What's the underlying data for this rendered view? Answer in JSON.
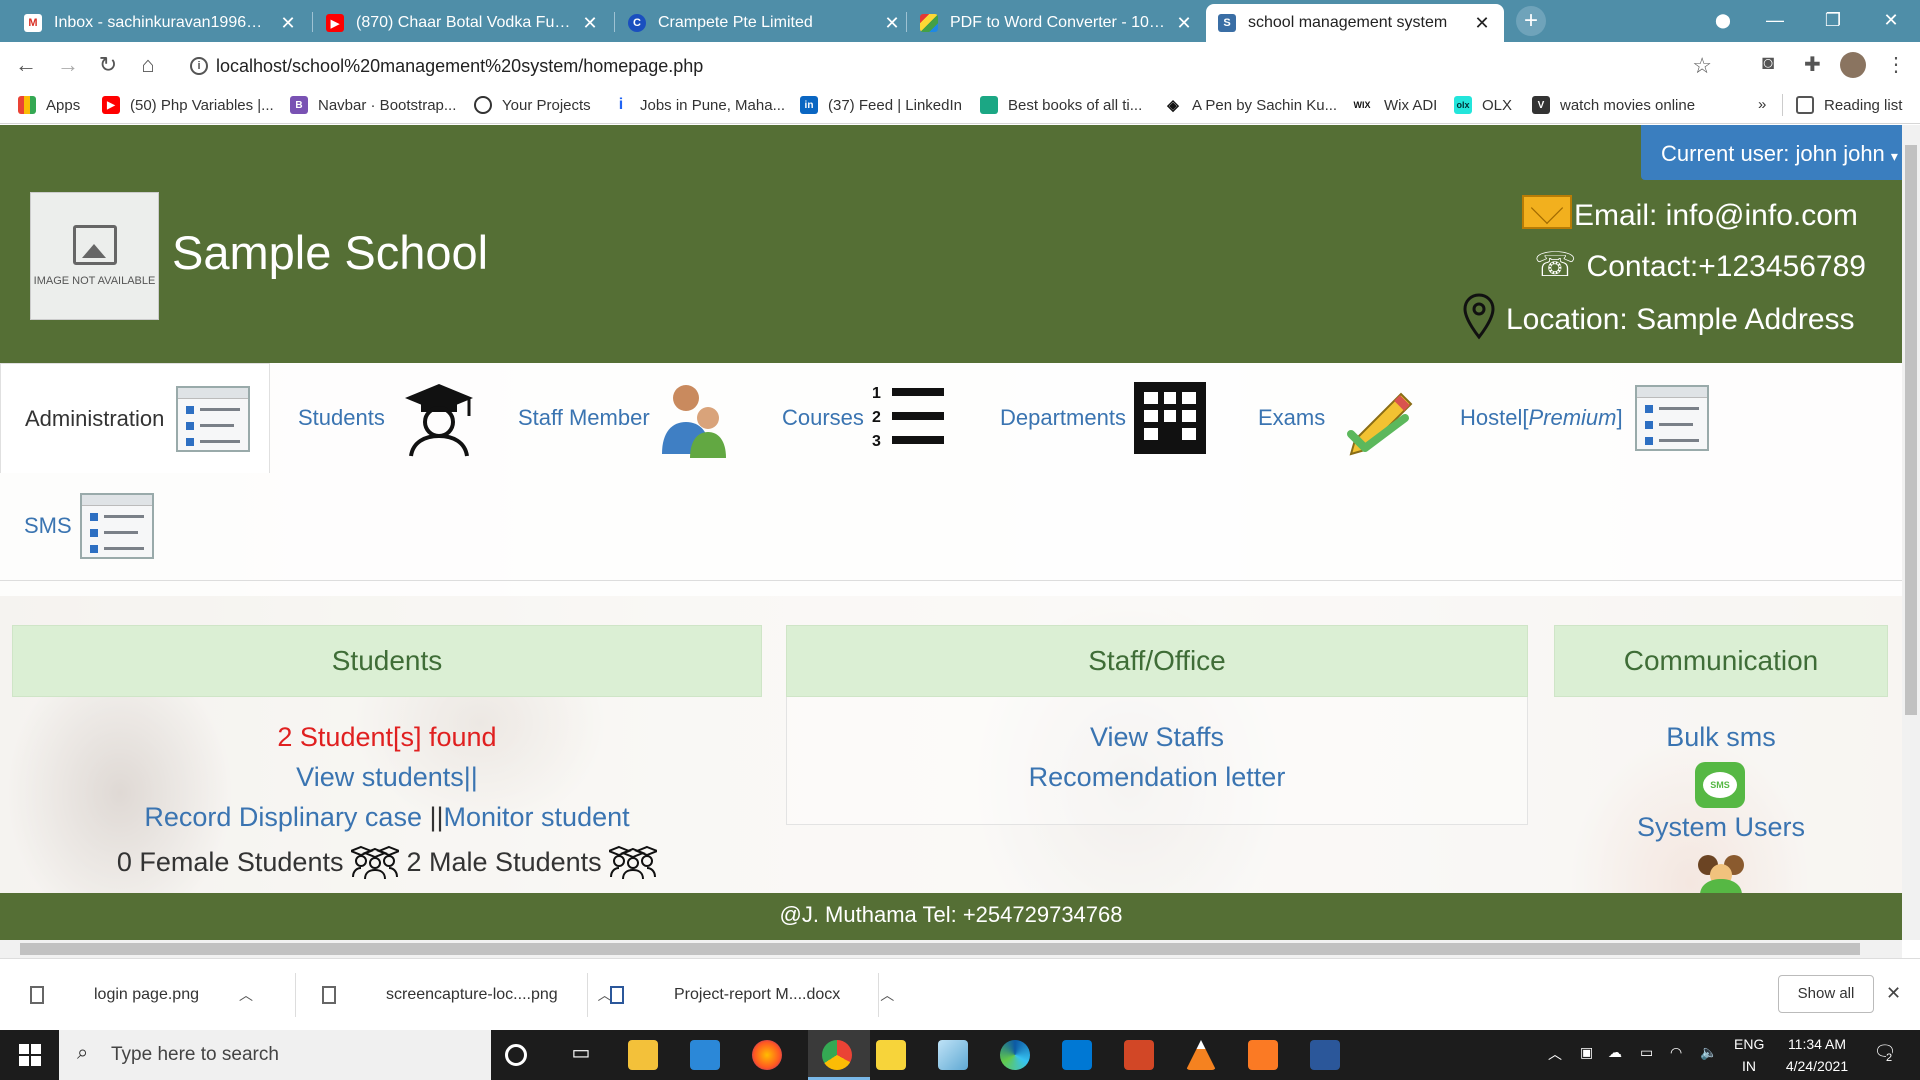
{
  "browser": {
    "tabs": [
      {
        "title": "Inbox - sachinkuravan1996@gma",
        "favicon": "gmail-icon"
      },
      {
        "title": "(870) Chaar Botal Vodka Full Son",
        "favicon": "youtube-icon"
      },
      {
        "title": "Crampete Pte Limited",
        "favicon": "crampete-icon"
      },
      {
        "title": "PDF to Word Converter - 100% F",
        "favicon": "pdf-converter-icon"
      },
      {
        "title": "school management system",
        "favicon": "s-icon"
      }
    ],
    "url": "localhost/school%20management%20system/homepage.php",
    "bookmarks": [
      "Apps",
      "(50) Php Variables |...",
      "Navbar · Bootstrap...",
      "Your Projects",
      "Jobs in Pune, Maha...",
      "(37) Feed | LinkedIn",
      "Best books of all ti...",
      "A Pen by Sachin Ku...",
      "Wix ADI",
      "OLX",
      "watch movies online"
    ],
    "more_bookmarks": "»",
    "reading_list": "Reading list"
  },
  "page": {
    "current_user": "Current user: john john",
    "logo_text": "IMAGE NOT AVAILABLE",
    "school_name": "Sample School",
    "email": "Email: info@info.com",
    "contact": "Contact:+123456789",
    "location": "Location: Sample Address",
    "menu": {
      "administration": "Administration",
      "students": "Students",
      "staff": "Staff Member",
      "courses": "Courses",
      "departments": "Departments",
      "exams": "Exams",
      "hostel": "Hostel[",
      "hostel_premium": "Premium",
      "hostel_end": "]",
      "sms": "SMS"
    },
    "panels": {
      "students": {
        "title": "Students",
        "found": "2 Student[s] found",
        "view": "View students||",
        "record": "Record Displinary case",
        "sep": "||",
        "monitor": "Monitor student",
        "female": "0 Female Students",
        "male": "2 Male Students"
      },
      "staff": {
        "title": "Staff/Office",
        "view": "View Staffs",
        "letter": "Recomendation letter"
      },
      "communication": {
        "title": "Communication",
        "bulk": "Bulk sms",
        "sms_icon_text": "SMS",
        "users": "System Users"
      }
    },
    "footer": "@J. Muthama Tel: +254729734768"
  },
  "downloads": {
    "items": [
      "login page.png",
      "screencapture-loc....png",
      "Project-report M....docx"
    ],
    "show_all": "Show all"
  },
  "taskbar": {
    "search_placeholder": "Type here to search",
    "lang": "ENG",
    "region": "IN",
    "time": "11:34 AM",
    "date": "4/24/2021",
    "notifications": "2"
  },
  "colors": {
    "header_green": "#556f35",
    "tab_bar": "#4f8ea8",
    "link_blue": "#3a74b1",
    "panel_head": "#dbefd4",
    "user_button": "#3a7ebf"
  }
}
